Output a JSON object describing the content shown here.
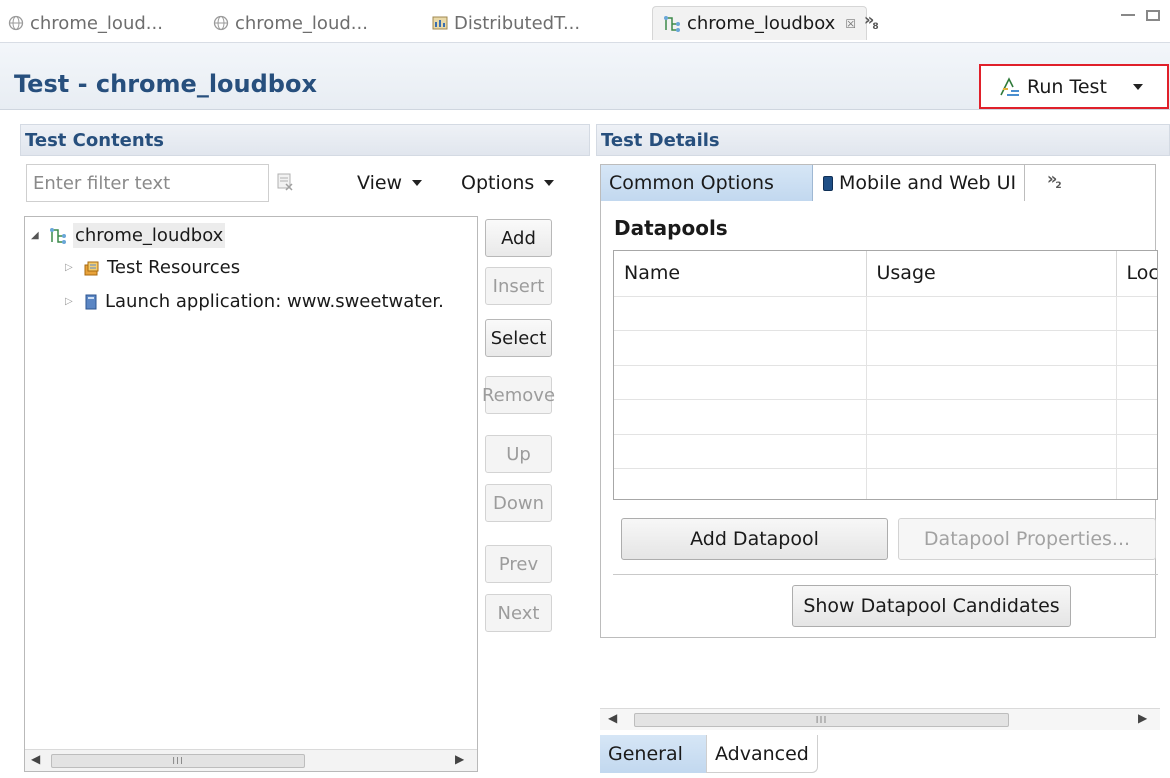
{
  "editor_tabs": [
    {
      "label": "chrome_loud...",
      "icon": "globe-icon",
      "active": false
    },
    {
      "label": "chrome_loud...",
      "icon": "globe-icon",
      "active": false
    },
    {
      "label": "DistributedT...",
      "icon": "schedule-icon",
      "active": false
    },
    {
      "label": "chrome_loudbox",
      "icon": "test-icon",
      "active": true,
      "close": "☒"
    }
  ],
  "editor_tabs_overflow": "»",
  "editor_tabs_overflow_count": "8",
  "header": {
    "title": "Test - chrome_loudbox",
    "run_button_label": "Run Test"
  },
  "left": {
    "section_title": "Test Contents",
    "filter_placeholder": "Enter filter text",
    "view_menu": "View",
    "options_menu": "Options",
    "tree": [
      {
        "label": "chrome_loudbox",
        "icon": "test-icon",
        "expanded": true,
        "level": 0
      },
      {
        "label": "Test Resources",
        "icon": "resources-icon",
        "expanded": false,
        "level": 1
      },
      {
        "label": "Launch application: www.sweetwater.",
        "icon": "page-icon",
        "expanded": false,
        "level": 1
      }
    ],
    "buttons": {
      "add": "Add",
      "insert": "Insert",
      "select": "Select",
      "remove": "Remove",
      "up": "Up",
      "down": "Down",
      "prev": "Prev",
      "next": "Next"
    },
    "scroll_grip": "III"
  },
  "right": {
    "section_title": "Test Details",
    "tabs": {
      "common": "Common Options",
      "mobile": "Mobile and Web UI",
      "overflow": "»",
      "overflow_count": "2"
    },
    "datapools_title": "Datapools",
    "columns": [
      "Name",
      "Usage",
      "Loc"
    ],
    "empty_rows": 6,
    "add_datapool": "Add Datapool",
    "datapool_properties": "Datapool Properties...",
    "show_candidates": "Show Datapool Candidates",
    "scroll_grip": "III",
    "bottom_tabs": {
      "general": "General",
      "advanced": "Advanced"
    }
  },
  "colors": {
    "title_blue": "#274f7d",
    "highlight_red": "#e0202a",
    "tab_active_blue": "#c2d8ef"
  }
}
